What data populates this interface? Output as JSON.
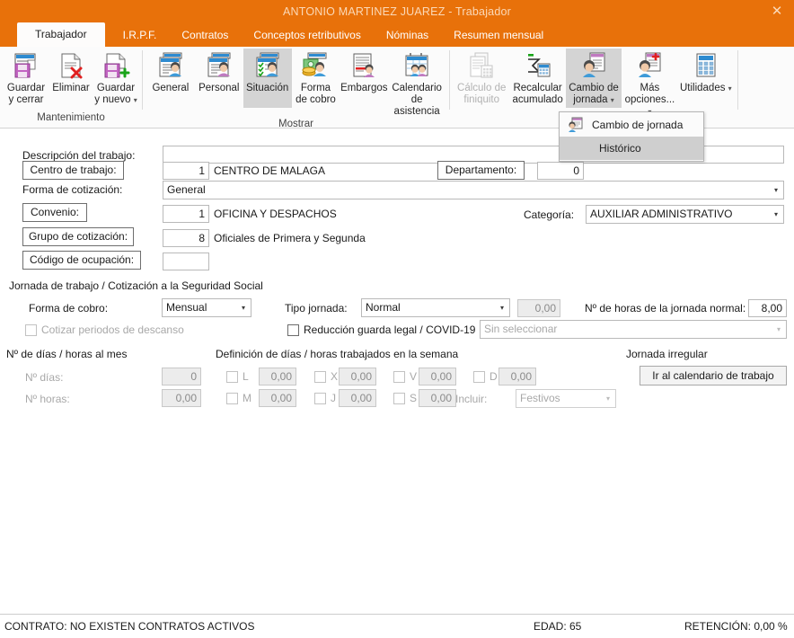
{
  "window": {
    "title": "ANTONIO MARTINEZ JUAREZ - Trabajador",
    "close_label": "✕",
    "accent_color": "#e8710a"
  },
  "tabs": [
    {
      "label": "Trabajador",
      "active": true
    },
    {
      "label": "I.R.P.F.",
      "active": false
    },
    {
      "label": "Contratos",
      "active": false
    },
    {
      "label": "Conceptos retributivos",
      "active": false
    },
    {
      "label": "Nóminas",
      "active": false
    },
    {
      "label": "Resumen mensual",
      "active": false
    }
  ],
  "ribbon": {
    "groups": [
      {
        "title": "Mantenimiento",
        "buttons": [
          {
            "label": "Guardar\ny cerrar",
            "icon": "save-close-icon",
            "state": "normal",
            "caret": false
          },
          {
            "label": "Eliminar",
            "icon": "delete-icon",
            "state": "normal",
            "caret": false
          },
          {
            "label": "Guardar\ny nuevo",
            "icon": "save-new-icon",
            "state": "normal",
            "caret": true
          }
        ]
      },
      {
        "title": "Mostrar",
        "buttons": [
          {
            "label": "General",
            "icon": "general-icon",
            "state": "normal",
            "caret": false
          },
          {
            "label": "Personal",
            "icon": "personal-icon",
            "state": "normal",
            "caret": false
          },
          {
            "label": "Situación",
            "icon": "situacion-icon",
            "state": "selected",
            "caret": false
          },
          {
            "label": "Forma\nde cobro",
            "icon": "forma-cobro-icon",
            "state": "normal",
            "caret": false
          },
          {
            "label": "Embargos",
            "icon": "embargos-icon",
            "state": "normal",
            "caret": false
          },
          {
            "label": "Calendario\nde asistencia",
            "icon": "calendario-asistencia-icon",
            "state": "normal",
            "caret": false
          }
        ]
      },
      {
        "title": "",
        "buttons": [
          {
            "label": "Cálculo de\nfiniquito",
            "icon": "calculo-finiquito-icon",
            "state": "disabled",
            "caret": false
          },
          {
            "label": "Recalcular\nacumulado",
            "icon": "recalcular-acumulado-icon",
            "state": "normal",
            "caret": false
          },
          {
            "label": "Cambio de\njornada",
            "icon": "cambio-jornada-icon",
            "state": "menu-open",
            "caret": true
          },
          {
            "label": "Más\nopciones...",
            "icon": "mas-opciones-icon",
            "state": "normal",
            "caret": true
          },
          {
            "label": "Utilidades",
            "icon": "utilidades-icon",
            "state": "normal",
            "caret": true
          }
        ]
      }
    ]
  },
  "dropdown": {
    "items": [
      {
        "label": "Cambio de jornada",
        "icon": "cambio-jornada-small-icon",
        "hovered": false
      },
      {
        "label": "Histórico",
        "icon": "",
        "hovered": true
      }
    ]
  },
  "form": {
    "descripcion_label": "Descripción del trabajo:",
    "descripcion_value": "",
    "centro_trabajo_button": "Centro de trabajo:",
    "centro_trabajo_code": "1",
    "centro_trabajo_name": "CENTRO DE MALAGA",
    "departamento_button": "Departamento:",
    "departamento_code": "0",
    "forma_cotizacion_label": "Forma de cotización:",
    "forma_cotizacion_value": "General",
    "convenio_button": "Convenio:",
    "convenio_code": "1",
    "convenio_name": "OFICINA Y DESPACHOS",
    "categoria_label": "Categoría:",
    "categoria_value": "AUXILIAR ADMINISTRATIVO",
    "grupo_cotizacion_button": "Grupo de cotización:",
    "grupo_cotizacion_code": "8",
    "grupo_cotizacion_name": "Oficiales de Primera y Segunda",
    "codigo_ocupacion_button": "Código de ocupación:",
    "codigo_ocupacion_value": "",
    "jornada_section_title": "Jornada de trabajo / Cotización a la Seguridad Social",
    "forma_cobro_label": "Forma de cobro:",
    "forma_cobro_value": "Mensual",
    "cotizar_descanso_label": "Cotizar periodos de descanso",
    "tipo_jornada_label": "Tipo jornada:",
    "tipo_jornada_value": "Normal",
    "tipo_jornada_extra": "0,00",
    "horas_jornada_label": "Nº de horas de la jornada normal:",
    "horas_jornada_value": "8,00",
    "reduccion_label": "Reducción guarda legal / COVID-19",
    "reduccion_value": "Sin seleccionar",
    "dias_horas_mes_title": "Nº de días / horas al mes",
    "n_dias_label": "Nº días:",
    "n_dias_value": "0",
    "n_horas_label": "Nº horas:",
    "n_horas_value": "0,00",
    "definicion_title": "Definición de días / horas trabajados en la semana",
    "weekdays": [
      {
        "code": "L",
        "value": "0,00"
      },
      {
        "code": "M",
        "value": "0,00"
      },
      {
        "code": "X",
        "value": "0,00"
      },
      {
        "code": "J",
        "value": "0,00"
      },
      {
        "code": "V",
        "value": "0,00"
      },
      {
        "code": "S",
        "value": "0,00"
      },
      {
        "code": "D",
        "value": "0,00"
      }
    ],
    "incluir_label": "Incluir:",
    "incluir_value": "Festivos",
    "jornada_irregular_title": "Jornada irregular",
    "calendario_button": "Ir al calendario de trabajo"
  },
  "statusbar": {
    "contrato": "CONTRATO: NO EXISTEN CONTRATOS ACTIVOS",
    "edad": "EDAD: 65",
    "retencion": "RETENCIÓN: 0,00 %"
  }
}
